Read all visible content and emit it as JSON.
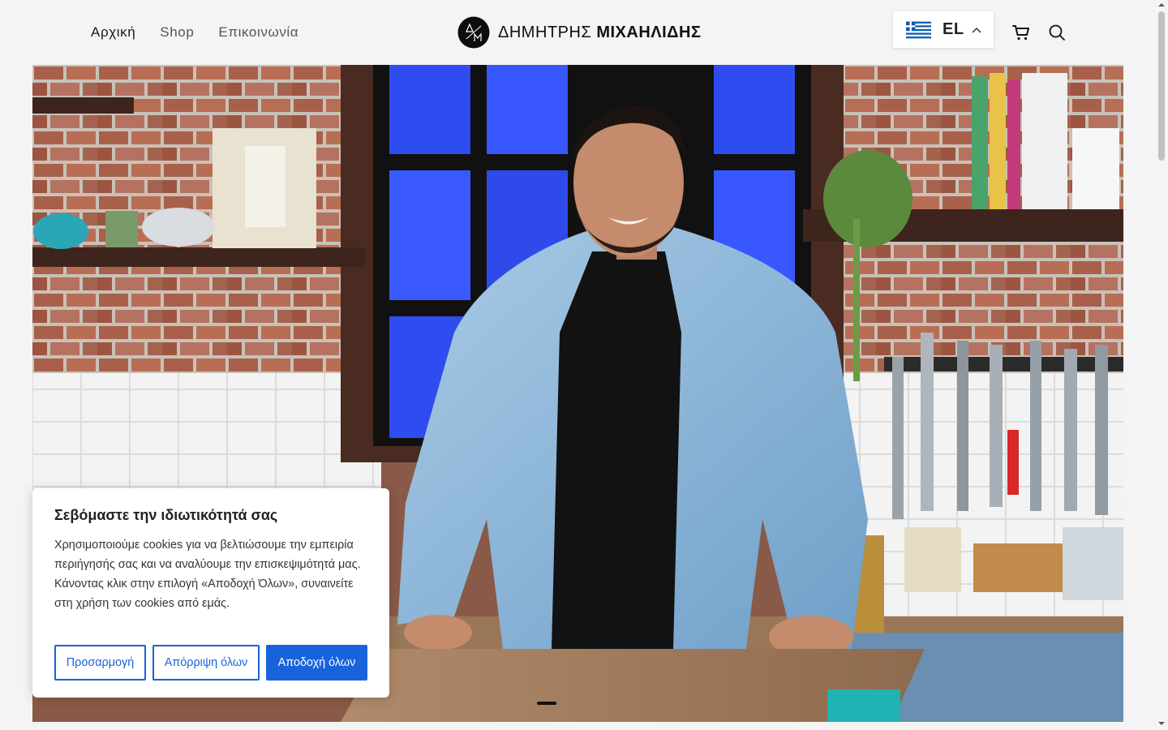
{
  "nav": {
    "items": [
      {
        "label": "Αρχική",
        "active": true
      },
      {
        "label": "Shop",
        "active": false
      },
      {
        "label": "Επικοινωνία",
        "active": false
      }
    ]
  },
  "brand": {
    "first_name": "ΔΗΜΗΤΡΗΣ",
    "last_name": "ΜΙΧΑΗΛΙΔΗΣ",
    "mark_letters": "Δ/Μ"
  },
  "language": {
    "code": "EL",
    "flag_icon": "greece-flag-icon"
  },
  "header_icons": [
    "cart-icon",
    "search-icon"
  ],
  "hero": {
    "image": "chef-in-kitchen-photo",
    "slide_indicator_active": 1
  },
  "cookie_banner": {
    "title": "Σεβόμαστε την ιδιωτικότητά σας",
    "text": "Χρησιμοποιούμε cookies για να βελτιώσουμε την εμπειρία περιήγησής σας και να αναλύουμε την επισκεψιμότητά μας. Κάνοντας κλικ στην επιλογή «Αποδοχή Όλων», συναινείτε στη χρήση των cookies από εμάς.",
    "customize_label": "Προσαρμογή",
    "reject_label": "Απόρριψη όλων",
    "accept_label": "Αποδοχή όλων"
  },
  "colors": {
    "accent": "#1863dc",
    "background": "#f4f4f4"
  }
}
